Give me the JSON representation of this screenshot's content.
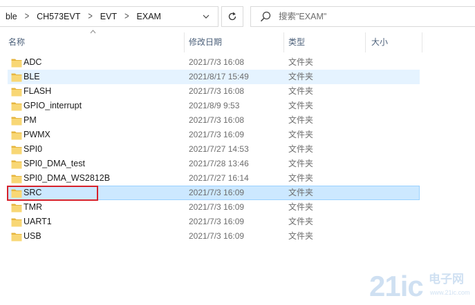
{
  "breadcrumb": {
    "items": [
      "ble",
      "CH573EVT",
      "EVT",
      "EXAM"
    ],
    "separator_icon": "chevron-right-icon",
    "dropdown_icon": "chevron-down-icon"
  },
  "toolbar": {
    "refresh_icon": "refresh-icon"
  },
  "search": {
    "placeholder": "搜索\"EXAM\"",
    "value": "",
    "icon": "search-icon"
  },
  "columns": {
    "name": "名称",
    "date": "修改日期",
    "type": "类型",
    "size": "大小",
    "sort_icon": "sort-up-icon"
  },
  "files": [
    {
      "name": "ADC",
      "date": "2021/7/3 16:08",
      "type": "文件夹",
      "state": "normal"
    },
    {
      "name": "BLE",
      "date": "2021/8/17 15:49",
      "type": "文件夹",
      "state": "hover"
    },
    {
      "name": "FLASH",
      "date": "2021/7/3 16:08",
      "type": "文件夹",
      "state": "normal"
    },
    {
      "name": "GPIO_interrupt",
      "date": "2021/8/9 9:53",
      "type": "文件夹",
      "state": "normal"
    },
    {
      "name": "PM",
      "date": "2021/7/3 16:08",
      "type": "文件夹",
      "state": "normal"
    },
    {
      "name": "PWMX",
      "date": "2021/7/3 16:09",
      "type": "文件夹",
      "state": "normal"
    },
    {
      "name": "SPI0",
      "date": "2021/7/27 14:53",
      "type": "文件夹",
      "state": "normal"
    },
    {
      "name": "SPI0_DMA_test",
      "date": "2021/7/28 13:46",
      "type": "文件夹",
      "state": "normal"
    },
    {
      "name": "SPI0_DMA_WS2812B",
      "date": "2021/7/27 16:14",
      "type": "文件夹",
      "state": "normal"
    },
    {
      "name": "SRC",
      "date": "2021/7/3 16:09",
      "type": "文件夹",
      "state": "selected"
    },
    {
      "name": "TMR",
      "date": "2021/7/3 16:09",
      "type": "文件夹",
      "state": "normal"
    },
    {
      "name": "UART1",
      "date": "2021/7/3 16:09",
      "type": "文件夹",
      "state": "normal"
    },
    {
      "name": "USB",
      "date": "2021/7/3 16:09",
      "type": "文件夹",
      "state": "normal"
    }
  ],
  "colors": {
    "folder": "#f8d775",
    "folder_dark": "#e6b53e",
    "selected_bg": "#cce8ff",
    "selected_border": "#99d1ff",
    "hover_bg": "#e5f3ff",
    "highlight": "#d6212b"
  },
  "watermark": {
    "brand": "21ic",
    "cn": "电子网",
    "url": "www.21ic.com"
  }
}
